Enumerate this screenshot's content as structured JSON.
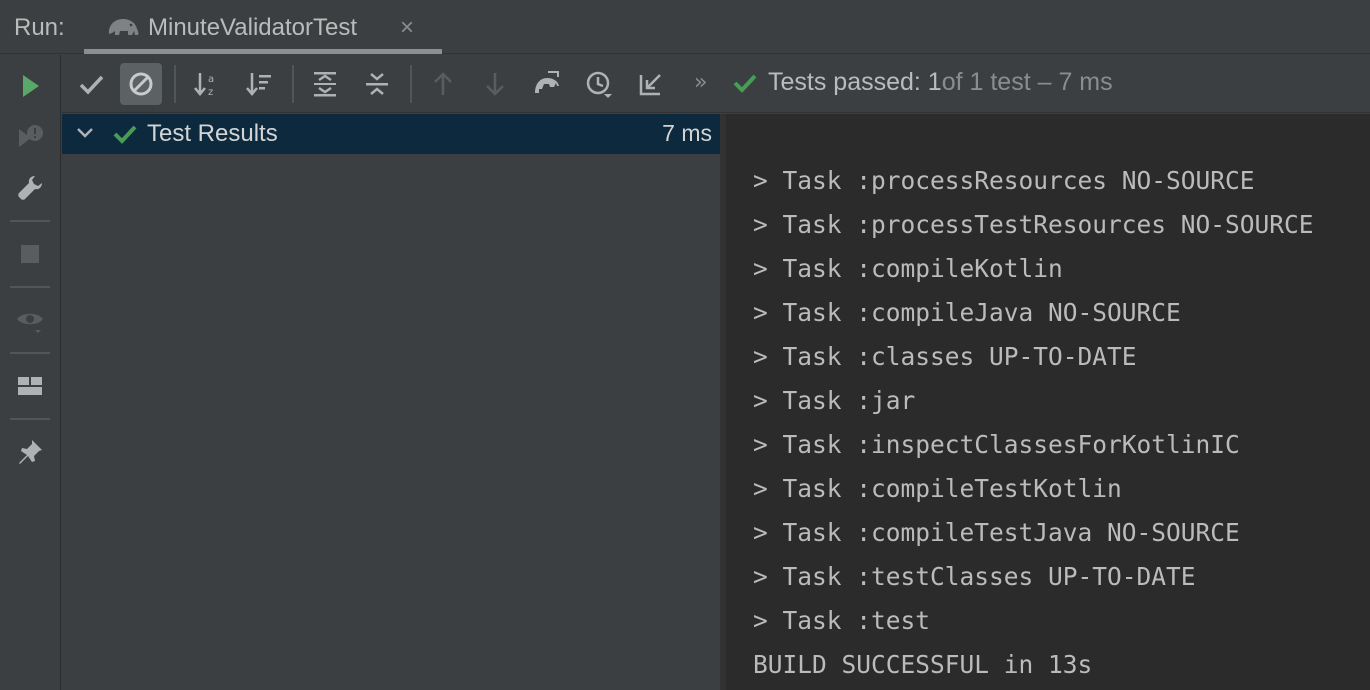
{
  "header": {
    "run_label": "Run:",
    "tab_title": "MinuteValidatorTest",
    "tab_close": "×",
    "tab_icon": "gradle-elephant-icon"
  },
  "left_toolbar": {
    "items": [
      "rerun-icon",
      "rerun-failed-icon",
      "wrench-icon",
      "stop-icon",
      "eye-icon",
      "layout-icon",
      "pin-icon"
    ]
  },
  "toolbar": {
    "items": [
      "show-passed-icon",
      "show-ignored-icon",
      "sort-alpha-icon",
      "sort-duration-icon",
      "expand-all-icon",
      "collapse-all-icon",
      "prev-failed-icon",
      "next-failed-icon",
      "gradle-icon",
      "history-icon",
      "import-tests-icon"
    ],
    "more": "»",
    "status_passed": "Tests passed: 1",
    "status_rest": " of 1 test – 7 ms"
  },
  "tree": {
    "root_label": "Test Results",
    "root_time": "7 ms"
  },
  "console": {
    "lines": [
      "> Task :processResources NO-SOURCE",
      "> Task :processTestResources NO-SOURCE",
      "> Task :compileKotlin",
      "> Task :compileJava NO-SOURCE",
      "> Task :classes UP-TO-DATE",
      "> Task :jar",
      "> Task :inspectClassesForKotlinIC",
      "> Task :compileTestKotlin",
      "> Task :compileTestJava NO-SOURCE",
      "> Task :testClasses UP-TO-DATE",
      "> Task :test",
      "BUILD SUCCESSFUL in 13s"
    ]
  },
  "colors": {
    "success_green": "#499c54",
    "run_green": "#59a869",
    "selection": "#0d293e",
    "console_bg": "#2b2b2b",
    "panel_bg": "#3c3f41"
  }
}
